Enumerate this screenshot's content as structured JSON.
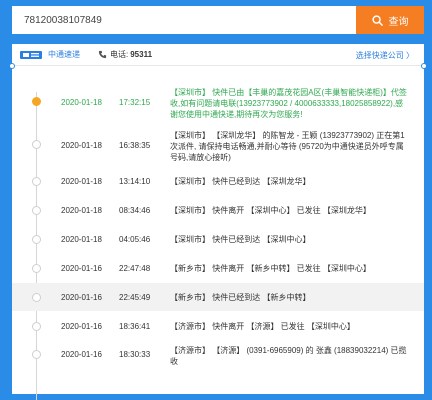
{
  "search": {
    "value": "78120038107849",
    "button_label": "查询"
  },
  "header": {
    "company": "中通速递",
    "phone_label": "电话:",
    "phone_number": "95311",
    "choose_link": "选择快递公司 〉"
  },
  "tracking": [
    {
      "date": "2020-01-18",
      "time": "17:32:15",
      "desc": "【深圳市】 快件已由【丰巢的嘉茂花园A区(丰巢智能快递柜)】代签收,如有问题请电联(13923773902 / 4000633333,18025858922),感谢您使用中通快递,期待再次为您服务!"
    },
    {
      "date": "2020-01-18",
      "time": "16:38:35",
      "desc": "【深圳市】 【深圳龙华】 的陈智龙 - 王颖 (13923773902) 正在第1次派件, 请保持电话畅通,并耐心等待 (95720为中通快递员外呼专属号码,请放心接听)"
    },
    {
      "date": "2020-01-18",
      "time": "13:14:10",
      "desc": "【深圳市】 快件已经到达 【深圳龙华】"
    },
    {
      "date": "2020-01-18",
      "time": "08:34:46",
      "desc": "【深圳市】 快件离开 【深圳中心】 已发往 【深圳龙华】"
    },
    {
      "date": "2020-01-18",
      "time": "04:05:46",
      "desc": "【深圳市】 快件已经到达 【深圳中心】"
    },
    {
      "date": "2020-01-16",
      "time": "22:47:48",
      "desc": "【新乡市】 快件离开 【新乡中转】 已发往 【深圳中心】"
    },
    {
      "date": "2020-01-16",
      "time": "22:45:49",
      "desc": "【新乡市】 快件已经到达 【新乡中转】"
    },
    {
      "date": "2020-01-16",
      "time": "18:36:41",
      "desc": "【济源市】 快件离开 【济源】 已发往 【深圳中心】"
    },
    {
      "date": "2020-01-16",
      "time": "18:30:33",
      "desc": "【济源市】 【济源】 (0391-6965909) 的 张鑫 (18839032214) 已揽收"
    }
  ],
  "colors": {
    "background": "#2b8ce8",
    "accent_button": "#f57d22",
    "link": "#2b7fe0",
    "delivered_text": "#2fa84f",
    "active_node": "#f5a623"
  }
}
